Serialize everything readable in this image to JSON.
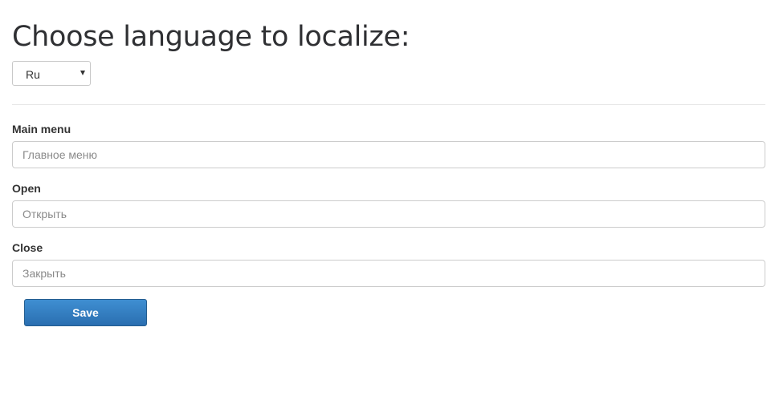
{
  "header": {
    "title": "Choose language to localize:"
  },
  "language_select": {
    "selected": "Ru",
    "icon": "caret-down-icon"
  },
  "fields": [
    {
      "label": "Main menu",
      "placeholder": "Главное меню",
      "value": ""
    },
    {
      "label": "Open",
      "placeholder": "Открыть",
      "value": ""
    },
    {
      "label": "Close",
      "placeholder": "Закрыть",
      "value": ""
    }
  ],
  "actions": {
    "save_label": "Save"
  },
  "colors": {
    "primary_button": "#337ab7",
    "input_border": "#cccccc",
    "heading": "#2f3033"
  }
}
